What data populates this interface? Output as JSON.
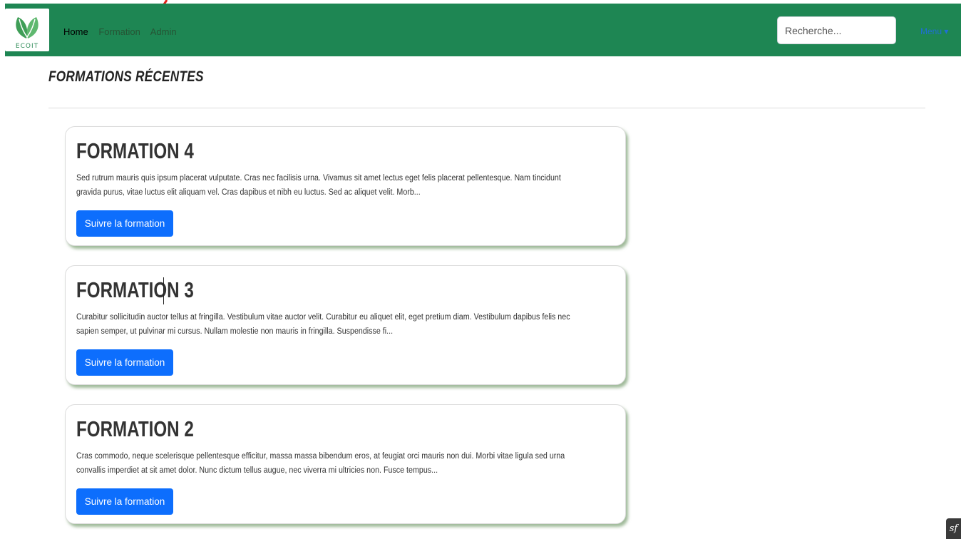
{
  "nav": {
    "brand": "ECOIT",
    "links": [
      "Home",
      "Formation",
      "Admin"
    ],
    "search_placeholder": "Recherche...",
    "user_menu": "Menu ▾"
  },
  "page": {
    "title": "FORMATIONS RÉCENTES"
  },
  "formations": [
    {
      "title": "FORMATION 4",
      "description": "Sed rutrum mauris quis ipsum placerat vulputate. Cras nec facilisis urna. Vivamus sit amet lectus eget felis placerat pellentesque. Nam tincidunt gravida purus, vitae luctus elit aliquam vel. Cras dapibus et nibh eu luctus. Sed ac aliquet velit. Morb...",
      "button": "Suivre la formation"
    },
    {
      "title": "FORMATION 3",
      "description": "Curabitur sollicitudin auctor tellus at fringilla. Vestibulum vitae auctor velit. Curabitur eu aliquet elit, eget pretium diam. Vestibulum dapibus felis nec sapien semper, ut pulvinar mi cursus. Nullam molestie non mauris in fringilla. Suspendisse fi...",
      "button": "Suivre la formation"
    },
    {
      "title": "FORMATION 2",
      "description": "Cras commodo, neque scelerisque pellentesque efficitur, massa massa bibendum eros, at feugiat orci mauris non dui. Morbi vitae ligula sed urna convallis imperdiet at sit amet dolor. Nunc dictum tellus augue, nec viverra mi ultricies non. Fusce tempus...",
      "button": "Suivre la formation"
    }
  ],
  "colors": {
    "navbar": "#1e8653",
    "button": "#0d6efd",
    "annotation_arrow": "#e8201a"
  },
  "icons": {
    "logo": "leaf-logo-icon",
    "debug": "symfony-toolbar-icon"
  }
}
